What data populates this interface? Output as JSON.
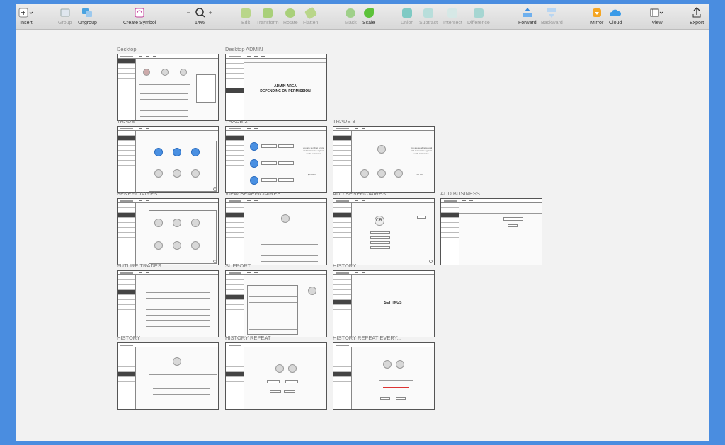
{
  "toolbar": {
    "insert": "Insert",
    "group": "Group",
    "ungroup": "Ungroup",
    "create_symbol": "Create Symbol",
    "zoom": "14%",
    "edit": "Edit",
    "transform": "Transform",
    "rotate": "Rotate",
    "flatten": "Flatten",
    "mask": "Mask",
    "scale": "Scale",
    "union": "Union",
    "subtract": "Subtract",
    "intersect": "Intersect",
    "difference": "Difference",
    "forward": "Forward",
    "backward": "Backward",
    "mirror": "Mirror",
    "cloud": "Cloud",
    "view": "View",
    "export": "Export"
  },
  "artboards": {
    "desktop": "Desktop",
    "desktop_admin": "Desktop ADMIN",
    "trade": "TRADE",
    "trade2": "TRADE 2",
    "trade3": "TRADE 3",
    "beneficiaires": "BENEFICIAIRES",
    "view_beneficiaires": "VIEW BENEFICIAIRES",
    "add_beneficiaires": "ADD BENEFICIAIRES",
    "add_business": "ADD BUSINESS",
    "future_trades": "FUTURE TRADES",
    "support": "SUPPORT",
    "history1": "HISTORY",
    "history2": "HISTORY",
    "history_repeat": "HISTORY REPEAT",
    "history_repeat_every": "HISTORY REPEAT EVERY..."
  },
  "content": {
    "admin_line1": "ADMIN AREA",
    "admin_line2": "DEPENDING ON PERMISSION",
    "settings": "SETTINGS",
    "initials": "CR",
    "trade_note": "you are sending a total of 4 currencies against each currencies",
    "amount": "$10 000"
  }
}
